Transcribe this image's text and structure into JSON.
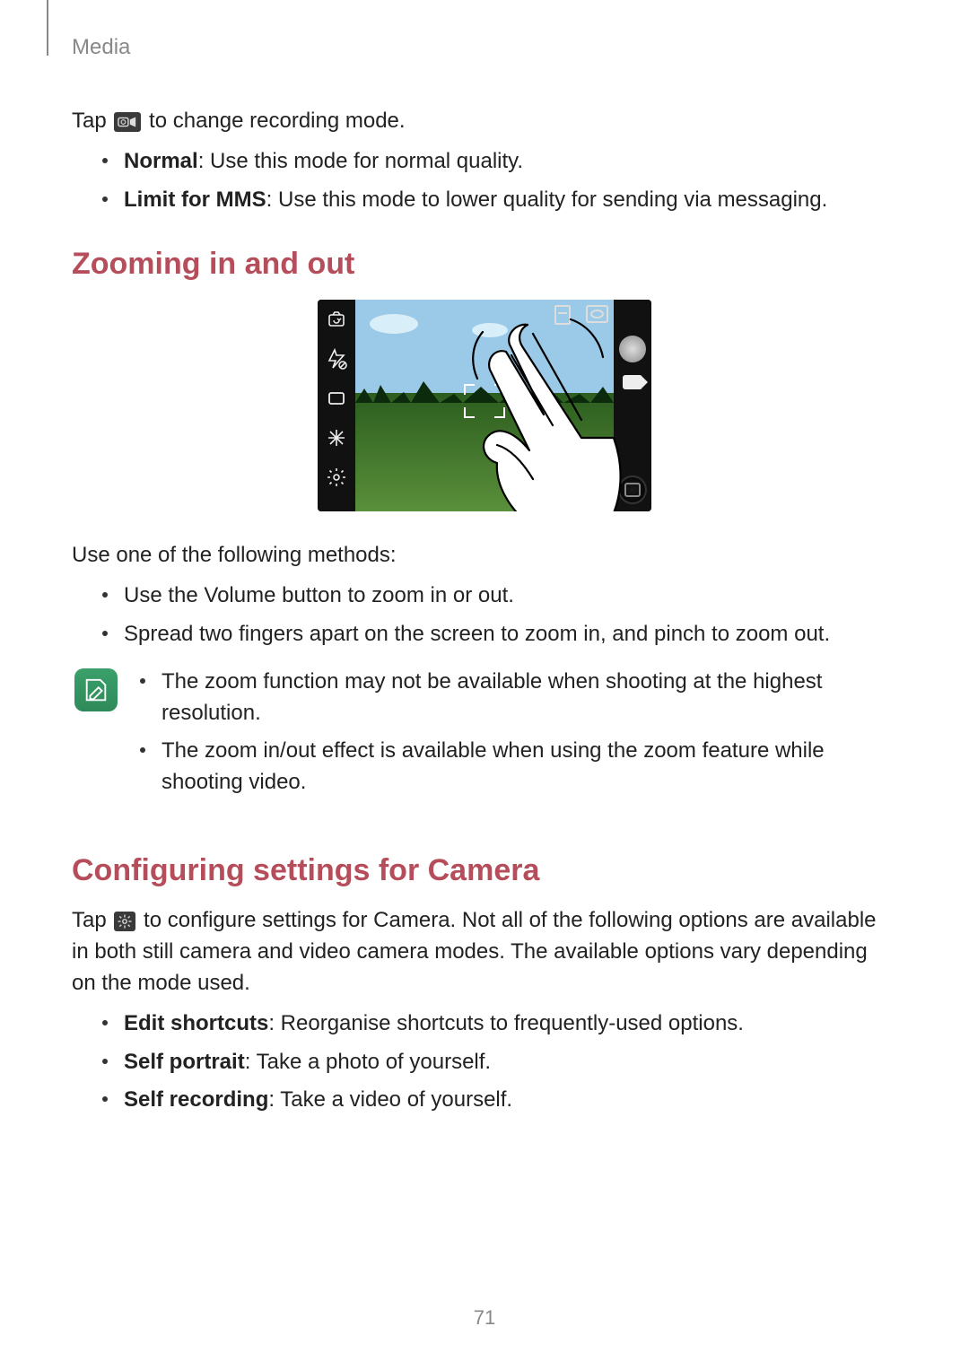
{
  "header": {
    "section": "Media"
  },
  "para1": {
    "prefix": "Tap ",
    "suffix": " to change recording mode.",
    "icon_name": "recording-mode-icon"
  },
  "mode_list": [
    {
      "name": "Normal",
      "desc": ": Use this mode for normal quality."
    },
    {
      "name": "Limit for MMS",
      "desc": ": Use this mode to lower quality for sending via messaging."
    }
  ],
  "h_zoom": "Zooming in and out",
  "zoom_intro": "Use one of the following methods:",
  "zoom_methods": [
    "Use the Volume button to zoom in or out.",
    "Spread two fingers apart on the screen to zoom in, and pinch to zoom out."
  ],
  "zoom_notes": [
    "The zoom function may not be available when shooting at the highest resolution.",
    "The zoom in/out effect is available when using the zoom feature while shooting video."
  ],
  "h_config": "Configuring settings for Camera",
  "config_para": {
    "prefix": "Tap ",
    "suffix": " to configure settings for Camera. Not all of the following options are available in both still camera and video camera modes. The available options vary depending on the mode used.",
    "icon_name": "settings-gear-icon"
  },
  "config_list": [
    {
      "name": "Edit shortcuts",
      "desc": ": Reorganise shortcuts to frequently-used options."
    },
    {
      "name": "Self portrait",
      "desc": ": Take a photo of yourself."
    },
    {
      "name": "Self recording",
      "desc": ": Take a video of yourself."
    }
  ],
  "page_number": "71",
  "camera_ui": {
    "left_icons": [
      "switch-camera-icon",
      "flash-off-icon",
      "mode-box-icon",
      "effects-icon",
      "settings-gear-icon"
    ],
    "right_controls": [
      "capture-photo-button",
      "record-video-button",
      "gallery-thumbnail-button"
    ],
    "overlay_icons": [
      "memory-indicator-icon",
      "camera-top-icon",
      "autofocus-frame"
    ]
  }
}
